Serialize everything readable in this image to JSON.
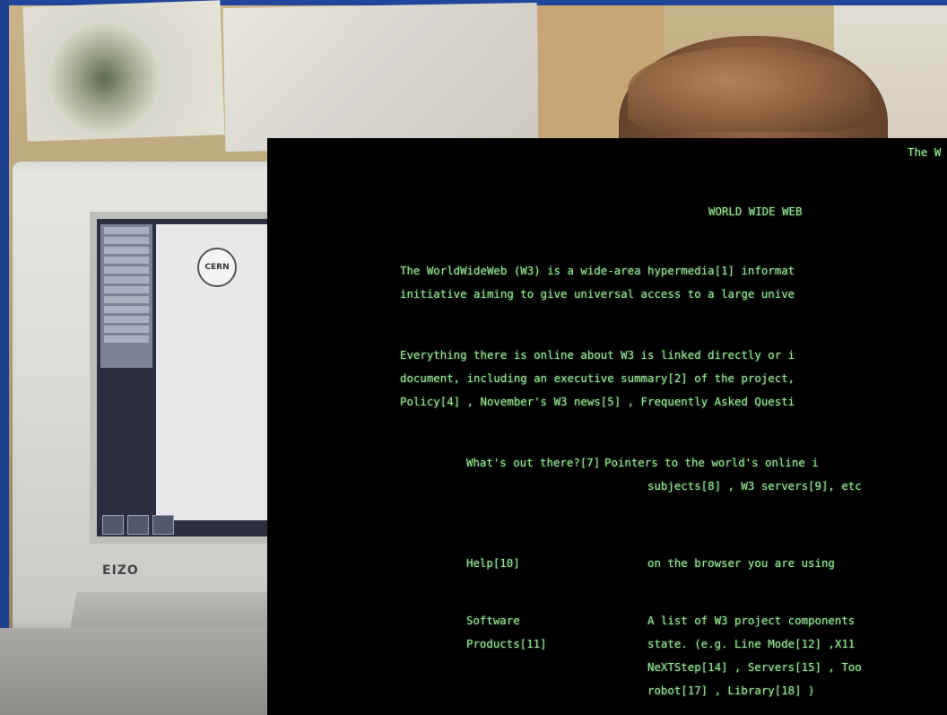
{
  "terminal": {
    "top_right_title": "The W",
    "heading": "WORLD WIDE WEB",
    "intro": [
      "The WorldWideWeb (W3) is a wide-area hypermedia[1] informat",
      "initiative aiming to give universal access to a large unive"
    ],
    "paragraph2": [
      "Everything there is online about W3 is linked directly or i",
      "document, including an executive summary[2] of the project,",
      "Policy[4] , November's W3 news[5] , Frequently Asked Questi"
    ],
    "entries": [
      {
        "label": [
          "What's out there?[7]"
        ],
        "desc": [
          "Pointers to the world's online i",
          "subjects[8] , W3 servers[9], etc"
        ]
      },
      {
        "label": [
          "Help[10]"
        ],
        "desc": [
          "on the browser you are using"
        ]
      },
      {
        "label": [
          "Software",
          "Products[11]"
        ],
        "desc": [
          "A list of W3 project components",
          "state. (e.g. Line Mode[12] ,X11",
          "NeXTStep[14] , Servers[15] , Too",
          "robot[17] , Library[18] )"
        ]
      }
    ]
  },
  "monitor": {
    "brand": "EIZO",
    "screen_logo": "CERN"
  },
  "colors": {
    "terminal_bg": "#000000",
    "terminal_text": "#9be39b"
  }
}
